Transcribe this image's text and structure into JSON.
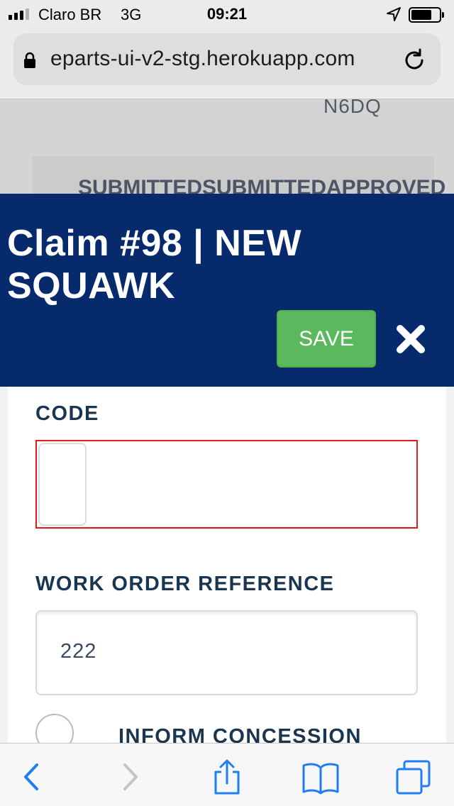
{
  "status_bar": {
    "carrier": "Claro BR",
    "network": "3G",
    "time": "09:21",
    "icons": [
      "signal-icon",
      "location-arrow-icon",
      "battery-icon"
    ]
  },
  "browser": {
    "url": "eparts-ui-v2-stg.herokuapp.com",
    "icons": [
      "lock-icon",
      "reload-icon"
    ]
  },
  "background_page": {
    "code_text": "N6DQ",
    "status_text": "SUBMITTEDSUBMITTEDAPPROVED"
  },
  "modal": {
    "title": "Claim #98 | NEW SQUAWK",
    "save_label": "SAVE",
    "close_icon": "close-icon",
    "fields": {
      "code_label": "CODE",
      "code_value": "",
      "work_order_label": "WORK ORDER REFERENCE",
      "work_order_value": "222",
      "inform_concession_label": "INFORM CONCESSION"
    }
  },
  "toolbar": {
    "icons": [
      "back-icon",
      "forward-icon",
      "share-icon",
      "bookmarks-icon",
      "tabs-icon"
    ]
  },
  "colors": {
    "header_bg": "#062a6b",
    "save_green": "#5cb85c",
    "error_red": "#e51919",
    "label_navy": "#1a3550",
    "ios_blue": "#1f7ef5"
  }
}
